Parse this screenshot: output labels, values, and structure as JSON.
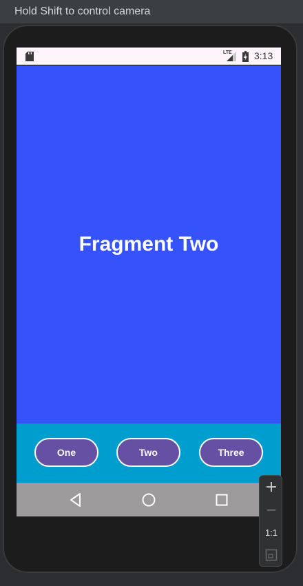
{
  "emulator": {
    "hint": "Hold Shift to control camera"
  },
  "status_bar": {
    "network": "LTE",
    "time": "3:13",
    "icons": [
      "sd-card-icon",
      "signal-icon",
      "battery-charging-icon"
    ]
  },
  "fragment": {
    "title": "Fragment Two",
    "background": "#3652fb"
  },
  "buttons": {
    "one": "One",
    "two": "Two",
    "three": "Three",
    "background": "#6650a4",
    "panel_background": "#009ecf"
  },
  "nav_bar": {
    "icons": [
      "back-icon",
      "home-icon",
      "recents-icon"
    ]
  },
  "zoom_controls": {
    "zoom_in": "+",
    "zoom_out": "−",
    "actual_size": "1:1",
    "icons": [
      "zoom-in-icon",
      "zoom-out-icon",
      "fit-screen-icon"
    ]
  }
}
